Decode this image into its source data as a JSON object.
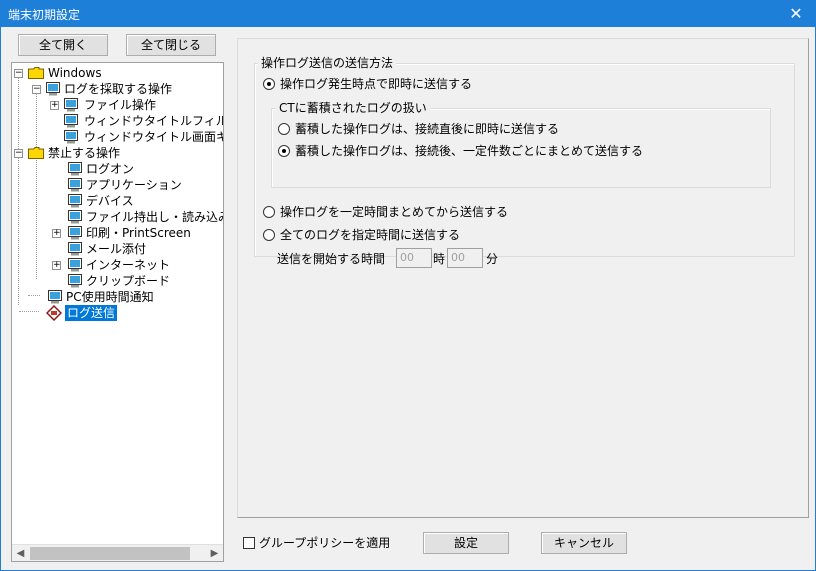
{
  "window": {
    "title": "端末初期設定",
    "close_icon": "close-icon"
  },
  "toolbar": {
    "expand_all": "全て開く",
    "collapse_all": "全て閉じる"
  },
  "tree": {
    "windows": "Windows",
    "collect_ops": "ログを採取する操作",
    "file_ops": "ファイル操作",
    "window_title_filter": "ウィンドウタイトルフィルタ",
    "window_title_screen": "ウィンドウタイトル画面キャ",
    "prohibited_ops": "禁止する操作",
    "logon": "ログオン",
    "application": "アプリケーション",
    "device": "デバイス",
    "file_transfer": "ファイル持出し・読み込み",
    "print": "印刷・PrintScreen",
    "mail_attach": "メール添付",
    "internet": "インターネット",
    "clipboard": "クリップボード",
    "pc_usage_notify": "PC使用時間通知",
    "log_send": "ログ送信"
  },
  "panel": {
    "group_title": "操作ログ送信の送信方法",
    "opt_immediate": "操作ログ発生時点で即時に送信する",
    "ct_group_title": "CTに蓄積されたログの扱い",
    "opt_ct_immediate": "蓄積した操作ログは、接続直後に即時に送信する",
    "opt_ct_batch": "蓄積した操作ログは、接続後、一定件数ごとにまとめて送信する",
    "opt_periodic": "操作ログを一定時間まとめてから送信する",
    "opt_scheduled": "全てのログを指定時間に送信する",
    "start_time_label": "送信を開始する時間",
    "hour_value": "00",
    "hour_unit": "時",
    "minute_value": "00",
    "minute_unit": "分",
    "selected": {
      "main": "immediate",
      "ct": "batch"
    }
  },
  "footer": {
    "group_policy_label": "グループポリシーを適用",
    "group_policy_checked": false,
    "settings_button": "設定",
    "cancel_button": "キャンセル"
  },
  "colors": {
    "titlebar": "#1e7fd8",
    "selection": "#0078d7",
    "folder": "#ffd700"
  }
}
